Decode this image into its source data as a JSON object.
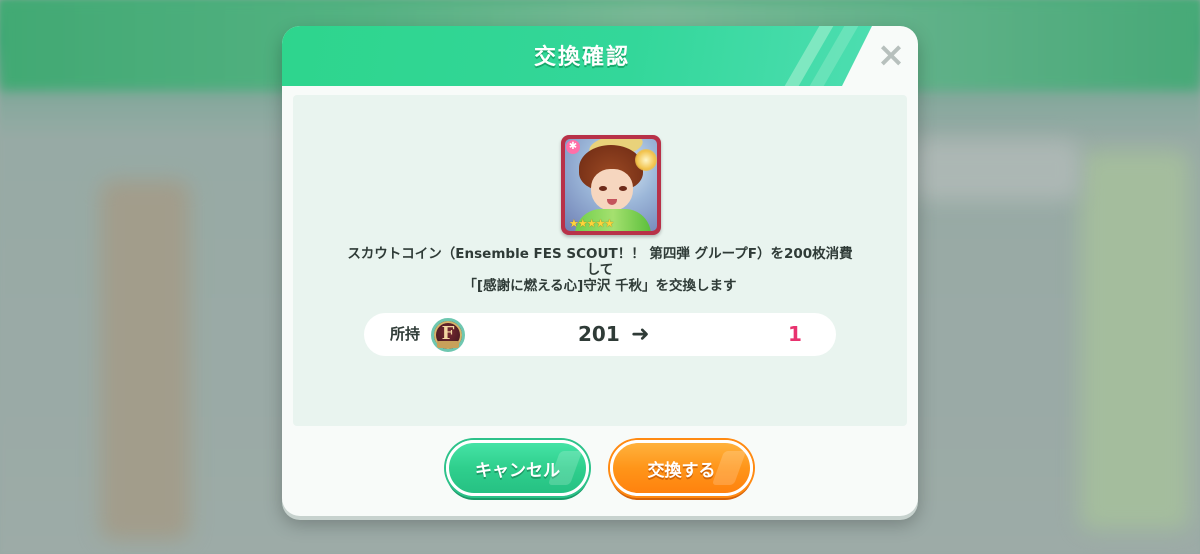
{
  "dialog": {
    "title": "交換確認",
    "close_icon": "×",
    "description_line1": "スカウトコイン（Ensemble FES SCOUT！！ 第四弾 グループF）を200枚消費",
    "description_line2": "して",
    "description_line3": "「[感謝に燃える心]守沢 千秋」を交換します",
    "card": {
      "rarity_stars": "★★★★★",
      "attribute_badge": "✱"
    },
    "owned": {
      "label": "所持",
      "coin_letter": "F",
      "before": "201",
      "arrow": "➜",
      "after": "1"
    },
    "buttons": {
      "cancel_label": "キャンセル",
      "exchange_label": "交換する"
    }
  },
  "colors": {
    "header_green": "#2ed58d",
    "cancel_green": "#2fcf8d",
    "exchange_orange": "#ff9519",
    "after_value_pink": "#e8326e"
  }
}
